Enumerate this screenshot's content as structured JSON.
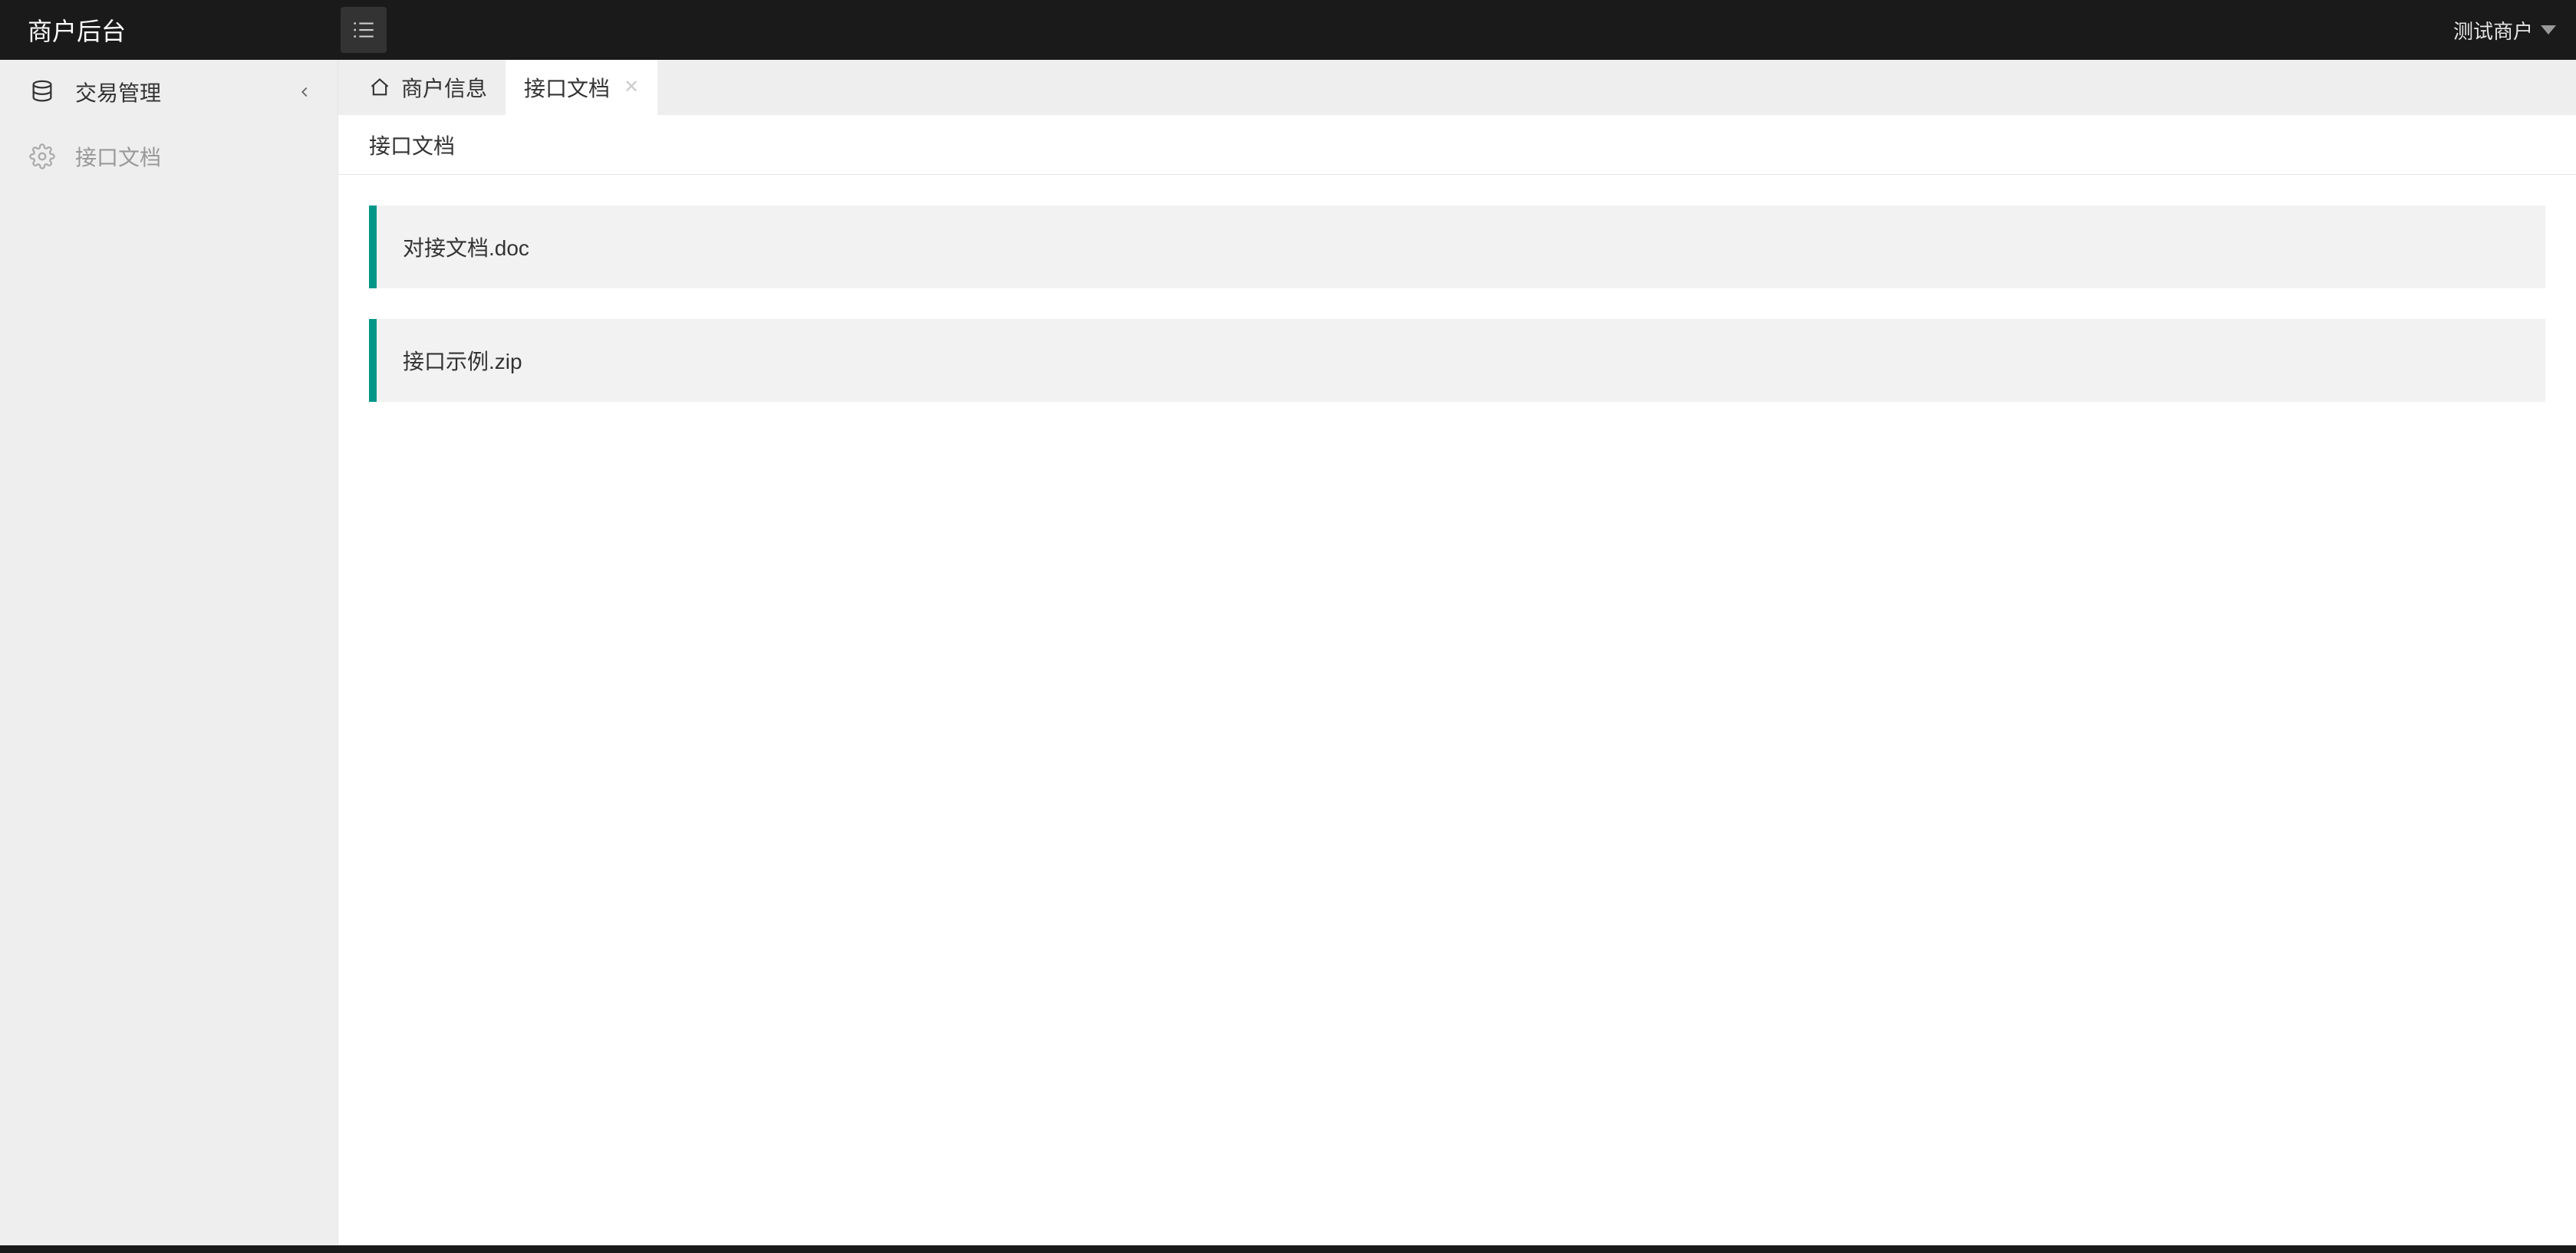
{
  "header": {
    "brand": "商户后台",
    "user_name": "测试商户"
  },
  "sidebar": {
    "items": [
      {
        "label": "交易管理",
        "icon": "database",
        "has_children": true
      },
      {
        "label": "接口文档",
        "icon": "gear",
        "has_children": false
      }
    ]
  },
  "tabs": [
    {
      "label": "商户信息",
      "type": "home",
      "closable": false,
      "active": false
    },
    {
      "label": "接口文档",
      "type": "normal",
      "closable": true,
      "active": true
    }
  ],
  "content": {
    "title": "接口文档",
    "files": [
      {
        "name": "对接文档.doc"
      },
      {
        "name": "接口示例.zip"
      }
    ]
  },
  "colors": {
    "accent": "#009688",
    "header_bg": "#1a1a1a",
    "sidebar_bg": "#eeeeee"
  }
}
